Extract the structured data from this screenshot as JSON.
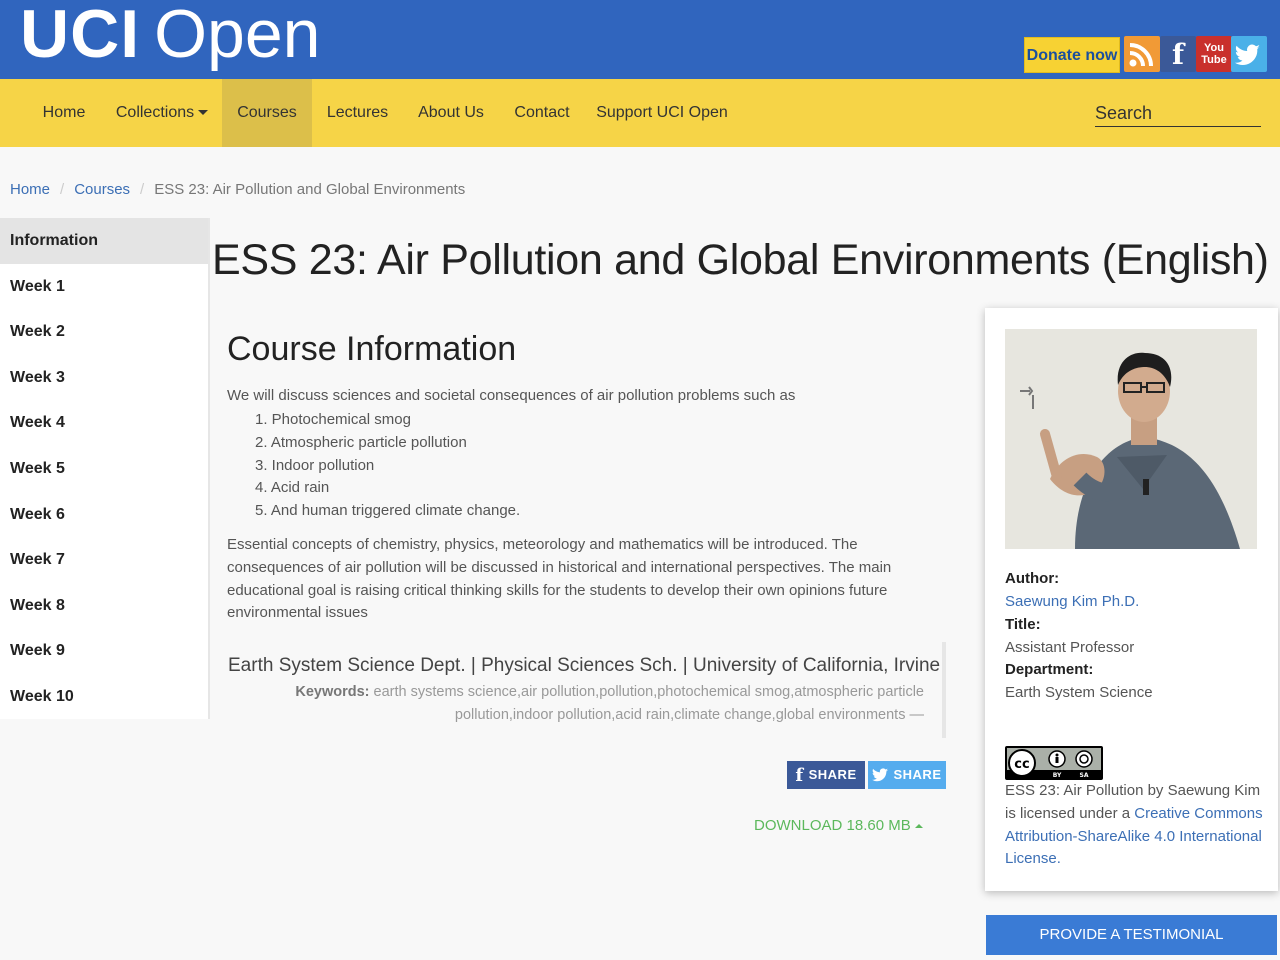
{
  "header": {
    "logo_uci": "UCI",
    "logo_open": "Open",
    "donate_label": "Donate now",
    "social": {
      "rss_icon": "rss-icon",
      "facebook_letter": "f",
      "youtube_top": "You",
      "youtube_bottom": "Tube",
      "twitter_icon": "twitter-bird-icon"
    },
    "colors": {
      "primary": "#3065be",
      "nav": "#f6d447",
      "donate": "#f7d233"
    }
  },
  "nav": {
    "items": [
      "Home",
      "Collections",
      "Courses",
      "Lectures",
      "About Us",
      "Contact",
      "Support UCI Open"
    ],
    "active": "Courses",
    "search_placeholder": "Search"
  },
  "breadcrumb": {
    "home": "Home",
    "courses": "Courses",
    "current": "ESS 23: Air Pollution and Global Environments"
  },
  "sidebar": {
    "items": [
      "Information",
      "Week 1",
      "Week 2",
      "Week 3",
      "Week 4",
      "Week 5",
      "Week 6",
      "Week 7",
      "Week 8",
      "Week 9",
      "Week 10"
    ],
    "active": "Information"
  },
  "main": {
    "title": "ESS 23: Air Pollution and Global Environments (English)",
    "section_title": "Course Information",
    "intro": "We will discuss sciences and societal consequences of air pollution problems such as",
    "topics": [
      "1. Photochemical smog",
      "2. Atmospheric particle pollution",
      "3. Indoor pollution",
      "4. Acid rain",
      "5. And human triggered climate change."
    ],
    "description": "Essential concepts of chemistry, physics, meteorology and mathematics will be introduced. The consequences of air pollution will be discussed in historical and international perspectives. The main educational goal is raising critical thinking skills for the students to develop their own opinions future environmental issues",
    "dept": "Earth System Science Dept. | Physical Sciences Sch. | University of California, Irvine",
    "keywords_label": "Keywords:",
    "keywords": "earth systems science,air pollution,pollution,photochemical smog,atmospheric particle pollution,indoor pollution,acid rain,climate change,global environments —",
    "share_fb_label": "SHARE",
    "share_tw_label": "SHARE",
    "download_label": "DOWNLOAD 18.60 MB",
    "colors": {
      "link": "#3c6fb5",
      "download": "#5cb85c"
    }
  },
  "instructor": {
    "author_label": "Author:",
    "author": "Saewung Kim Ph.D.",
    "title_label": "Title:",
    "title": "Assistant Professor",
    "department_label": "Department:",
    "department": "Earth System Science",
    "cc_by": "BY",
    "cc_sa": "SA",
    "license_pre": "ESS 23: Air Pollution by Saewung Kim is licensed under a ",
    "license_link": "Creative Commons Attribution-ShareAlike 4.0 International License",
    "license_post": "."
  },
  "testimonial_label": "PROVIDE A TESTIMONIAL"
}
